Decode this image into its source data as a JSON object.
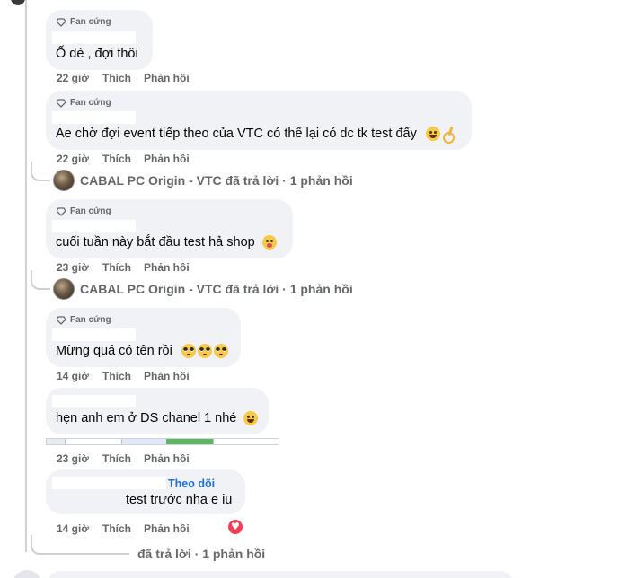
{
  "badge_label": "Fan cứng",
  "actions": {
    "like": "Thích",
    "reply": "Phản hồi"
  },
  "comments": [
    {
      "text": "Ố dè , đợi thôi",
      "time": "22 giờ"
    },
    {
      "text": "Ae chờ đợi event tiếp theo của VTC có thể lại có dc tk test đấy",
      "time": "22 giờ"
    },
    {
      "text": "cuối tuần này bắt đầu test hả shop",
      "time": "23 giờ"
    },
    {
      "text": "Mừng quá có tên rồi",
      "time": "14 giờ"
    },
    {
      "text": "hẹn anh em ở DS chanel 1 nhé",
      "time": "23 giờ"
    },
    {
      "text": "test trước nha e iu",
      "time": "14 giờ",
      "follow": "Theo dõi"
    }
  ],
  "replies": [
    {
      "text": "CABAL PC Origin - VTC đã trả lời · 1 phản hồi"
    },
    {
      "text": "CABAL PC Origin - VTC đã trả lời · 1 phản hồi"
    },
    {
      "text": "đã trả lời · 1 phản hồi"
    }
  ],
  "colors": {
    "follow": "#216fdb",
    "heart": "#f33e58",
    "bubble": "#f0f2f5"
  }
}
